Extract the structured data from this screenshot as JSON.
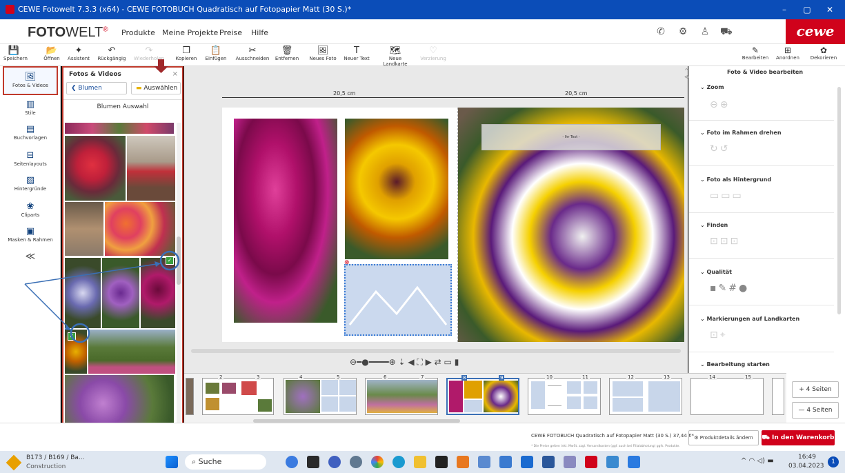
{
  "window": {
    "title": "CEWE Fotowelt 7.3.3 (x64) - CEWE FOTOBUCH Quadratisch auf Fotopapier Matt (30 S.)*",
    "minimize": "–",
    "maximize": "▢",
    "close": "✕"
  },
  "header": {
    "logo_bold": "FOTO",
    "logo_light": "WELT",
    "logo_mark": "®",
    "menu": [
      "Produkte",
      "Meine Projekte",
      "Preise",
      "Hilfe"
    ],
    "brand": "cewe"
  },
  "toolbar": {
    "items": [
      {
        "label": "Speichern",
        "icon": "💾"
      },
      {
        "label": "Öffnen",
        "icon": "📂"
      },
      {
        "label": "Assistent",
        "icon": "✦"
      },
      {
        "label": "Rückgängig",
        "icon": "↶"
      },
      {
        "label": "Wiederholen",
        "icon": "↷"
      },
      {
        "label": "Kopieren",
        "icon": "❐"
      },
      {
        "label": "Einfügen",
        "icon": "📋"
      },
      {
        "label": "Ausschneiden",
        "icon": "✂"
      },
      {
        "label": "Entfernen",
        "icon": "🗑"
      },
      {
        "label": "Neues Foto",
        "icon": "🖼"
      },
      {
        "label": "Neuer Text",
        "icon": "T"
      },
      {
        "label": "Neue Landkarte",
        "icon": "🗺"
      },
      {
        "label": "Verzierung",
        "icon": "♡"
      }
    ],
    "right_tabs": [
      {
        "label": "Bearbeiten",
        "icon": "✎"
      },
      {
        "label": "Anordnen",
        "icon": "⊞"
      },
      {
        "label": "Dekorieren",
        "icon": "✿"
      }
    ]
  },
  "leftnav": [
    {
      "label": "Fotos & Videos",
      "icon": "🖼"
    },
    {
      "label": "Stile",
      "icon": "▥"
    },
    {
      "label": "Buchvorlagen",
      "icon": "▤"
    },
    {
      "label": "Seitenlayouts",
      "icon": "⊟"
    },
    {
      "label": "Hintergründe",
      "icon": "▨"
    },
    {
      "label": "Cliparts",
      "icon": "❀"
    },
    {
      "label": "Masken & Rahmen",
      "icon": "▣"
    },
    {
      "label": "",
      "icon": "≪"
    }
  ],
  "photopanel": {
    "title": "Fotos & Videos",
    "close": "×",
    "back_label": "❮ Blumen",
    "select_label": "Auswählen",
    "album_name": "Blumen Auswahl"
  },
  "workarea": {
    "ruler_left": "20,5 cm",
    "ruler_right": "20,5 cm",
    "textbox": "- Ihr Text -",
    "zoom_controls": "⊖━●━━━━⊕ ⇣  ◀ ⛶ ▶   ⇄ ▭ ▮"
  },
  "rightpanel": {
    "title": "Foto & Video bearbeiten",
    "sections": [
      {
        "label": "Zoom",
        "icons": "⊖⊕"
      },
      {
        "label": "Foto im Rahmen drehen",
        "icons": "↻↺"
      },
      {
        "label": "Foto als Hintergrund",
        "icons": "▭▭▭"
      },
      {
        "label": "Finden",
        "icons": "⊡⊡⊡"
      },
      {
        "label": "Qualität",
        "icons": "▪✎#●"
      },
      {
        "label": "Markierungen auf Landkarten",
        "icons": "⊡⌖"
      },
      {
        "label": "Bearbeitung starten",
        "icons": ""
      }
    ]
  },
  "pagestrip": {
    "pages": [
      "2",
      "3",
      "4",
      "5",
      "6",
      "7",
      "8",
      "9",
      "10",
      "11",
      "12",
      "13",
      "14",
      "15"
    ]
  },
  "addpages": {
    "add": "+ 4 Seiten",
    "remove": "— 4 Seiten"
  },
  "bottombar": {
    "product": "CEWE FOTOBUCH Quadratisch auf Fotopapier Matt (30 S.) 37,44 €*",
    "note": "* Die Preise gelten inkl. MwSt. zzgl. Versandkosten (ggf. auch bei Filialabholung) ggfs. Produkte.",
    "details_button": "Produktdetails ändern",
    "cart_button": "In den Warenkorb",
    "view_controls": "⊖ ⊕ ▦ ▭ ▭ ▭ ▭  »  ⬚⌄"
  },
  "taskbar": {
    "weather_line1": "B173 / B169 / Ba...",
    "weather_line2": "Construction",
    "search_placeholder": "Suche",
    "time": "16:49",
    "date": "03.04.2023",
    "notifications": "1",
    "tray": "^ ◠ ◁) ▬"
  },
  "colors": {
    "accent_red": "#d0021b",
    "title_blue": "#0b4db8",
    "annotation_blue": "#3a6fb5",
    "highlight_red": "#c0392b"
  }
}
